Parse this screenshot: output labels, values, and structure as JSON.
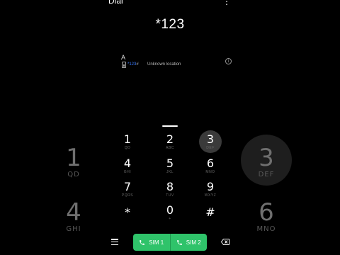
{
  "header": {
    "title": "Dial",
    "overflow": "⋮"
  },
  "dialer": {
    "entered_number": "*123"
  },
  "suggestion": {
    "avatar_letter": "A",
    "number_match": "*123",
    "number_rest": "#",
    "location": "Unknown location",
    "info_icon": "info-icon"
  },
  "keypad": {
    "keys": [
      {
        "digit": "1",
        "letters": "QD"
      },
      {
        "digit": "2",
        "letters": "ABC"
      },
      {
        "digit": "3",
        "letters": "DEF",
        "pressed": true
      },
      {
        "digit": "4",
        "letters": "GHI"
      },
      {
        "digit": "5",
        "letters": "JKL"
      },
      {
        "digit": "6",
        "letters": "MNO"
      },
      {
        "digit": "7",
        "letters": "PQRS"
      },
      {
        "digit": "8",
        "letters": "TUV"
      },
      {
        "digit": "9",
        "letters": "WXYZ"
      },
      {
        "digit": "*",
        "letters": ""
      },
      {
        "digit": "0",
        "letters": "+"
      },
      {
        "digit": "#",
        "letters": ""
      }
    ]
  },
  "bottom_bar": {
    "sim1_label": "SIM 1",
    "sim2_label": "SIM 2",
    "accent_color": "#2fc36a"
  },
  "backdrop": {
    "left": [
      {
        "digit": "1",
        "letters": "QD"
      },
      {
        "digit": "4",
        "letters": "GHI"
      }
    ],
    "right": [
      {
        "digit": "3",
        "letters": "DEF"
      },
      {
        "digit": "6",
        "letters": "MNO"
      }
    ]
  }
}
